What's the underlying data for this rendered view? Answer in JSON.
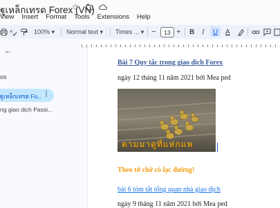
{
  "window": {
    "doc_title": "ฐูเหล็กเทรด Forex (VN)"
  },
  "title_icons": [
    "star-icon",
    "move-to-folder-icon",
    "cloud-status-icon"
  ],
  "menu": [
    "View",
    "Insert",
    "Format",
    "Tools",
    "Extensions",
    "Help"
  ],
  "toolbar": {
    "zoom": "100%",
    "style": "Normal text",
    "font": "Times ...",
    "font_size": "13",
    "minus": "−",
    "plus": "+",
    "bold": "B",
    "italic": "I",
    "underline": "U",
    "text_color": "A"
  },
  "sidebar": {
    "back": "←",
    "heading_fragment": "os",
    "active_item": "ฐูเหล็กเทรด Fo...",
    "more": "⋮",
    "item2": "ng giao dịch Passi..."
  },
  "document": {
    "heading_link": "Bài 7  Quy tắc trong giao dịch Forex",
    "date1": "ngày 12 tháng 11 năm 2021 bởi Mea ped",
    "image_caption": "ตามมาดูที่แห่กแพ",
    "orange_heading": "Theo tớ chớ có lạc đường!",
    "link2": "bài 6 tóm tắt tổng quan nhà giao dịch",
    "date2": "ngày 9 tháng 11 năm 2021 bởi Mea ped"
  },
  "colors": {
    "accent": "#0b57d0",
    "link": "#1a73e8",
    "orange": "#f29b11",
    "active_bg": "#c2e7ff"
  }
}
